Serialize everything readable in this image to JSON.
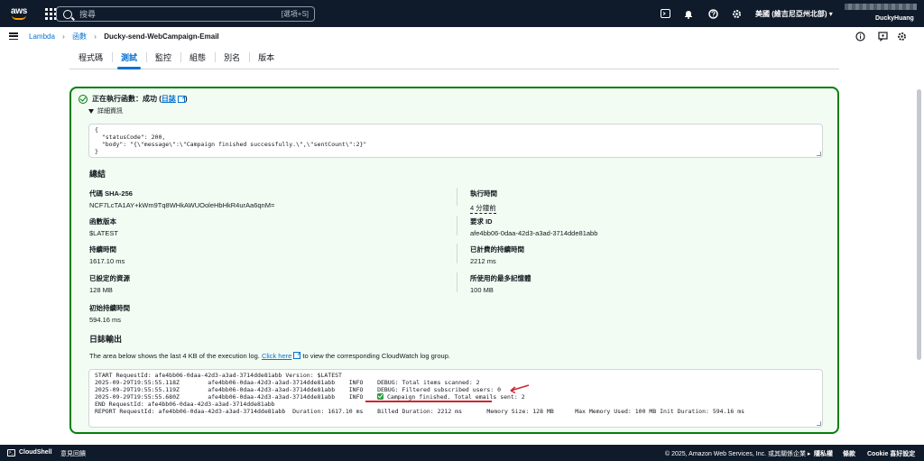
{
  "topnav": {
    "logo_text": "aws",
    "search_placeholder": "搜尋",
    "search_shortcut": "[選項+S]",
    "region": "美國 (維吉尼亞州北部) ▾",
    "account_name": "DuckyHuang"
  },
  "breadcrumb": {
    "items": [
      "Lambda",
      "函數"
    ],
    "current": "Ducky-send-WebCampaign-Email"
  },
  "tabs": [
    {
      "label": "程式碼",
      "active": false
    },
    {
      "label": "測試",
      "active": true
    },
    {
      "label": "監控",
      "active": false
    },
    {
      "label": "組態",
      "active": false
    },
    {
      "label": "別名",
      "active": false
    },
    {
      "label": "版本",
      "active": false
    }
  ],
  "result": {
    "status_prefix": "正在執行函數：成功 (",
    "log_link": "日誌",
    "status_suffix": ")",
    "details_label": "詳細資訊",
    "response_lines": [
      "{",
      "  \"statusCode\": 200,",
      "  \"body\": \"{\\\"message\\\":\\\"Campaign finished successfully.\\\",\\\"sentCount\\\":2}\"",
      "}"
    ]
  },
  "summary": {
    "title": "總結",
    "left": [
      {
        "key": "代碼 SHA-256",
        "value": "NCF7LcTA1AY+kWm9Tq8WHkAWUOoleHbHkR4urAa6qnM="
      },
      {
        "key": "函數版本",
        "value": "$LATEST"
      },
      {
        "key": "持續時間",
        "value": "1617.10 ms"
      },
      {
        "key": "已設定的資源",
        "value": "128 MB"
      },
      {
        "key": "初始持續時間",
        "value": "594.16 ms"
      }
    ],
    "right": [
      {
        "key": "執行時間",
        "value": "4 分鐘前"
      },
      {
        "key": "要求 ID",
        "value": "afe4bb06-0daa-42d3-a3ad-3714dde81abb"
      },
      {
        "key": "已計費的持續時間",
        "value": "2212 ms"
      },
      {
        "key": "所使用的最多記憶體",
        "value": "100 MB"
      }
    ]
  },
  "log": {
    "title": "日誌輸出",
    "desc_before": "The area below shows the last 4 KB of the execution log. ",
    "desc_link": "Click here",
    "desc_after": " to view the corresponding CloudWatch log group.",
    "lines": [
      "START RequestId: afe4bb06-0daa-42d3-a3ad-3714dde81abb Version: $LATEST",
      "2025-09-29T19:55:55.118Z        afe4bb06-0daa-42d3-a3ad-3714dde81abb    INFO    DEBUG: Total items scanned: 2",
      "2025-09-29T19:55:55.119Z        afe4bb06-0daa-42d3-a3ad-3714dde81abb    INFO    DEBUG: Filtered subscribed users: 0",
      "2025-09-29T19:55:55.680Z        afe4bb06-0daa-42d3-a3ad-3714dde81abb    INFO    ",
      "END RequestId: afe4bb06-0daa-42d3-a3ad-3714dde81abb",
      "REPORT RequestId: afe4bb06-0daa-42d3-a3ad-3714dde81abb  Duration: 1617.10 ms    Billed Duration: 2212 ms       Memory Size: 128 MB      Max Memory Used: 100 MB Init Duration: 594.16 ms"
    ],
    "highlight_text": " Campaign finished. Total emails sent: 2"
  },
  "footer": {
    "cloudshell": "CloudShell",
    "feedback": "意見回饋",
    "copyright": "© 2025, Amazon Web Services, Inc. 或其關係企業 ▸",
    "privacy": "隱私權",
    "terms": "條款",
    "cookie": "Cookie 喜好設定"
  },
  "colors": {
    "nav_bg": "#0f1b2a",
    "link": "#0972d3",
    "success_border": "#037f0c",
    "success_bg": "#f2fcf3",
    "annotation": "#d1242f"
  }
}
